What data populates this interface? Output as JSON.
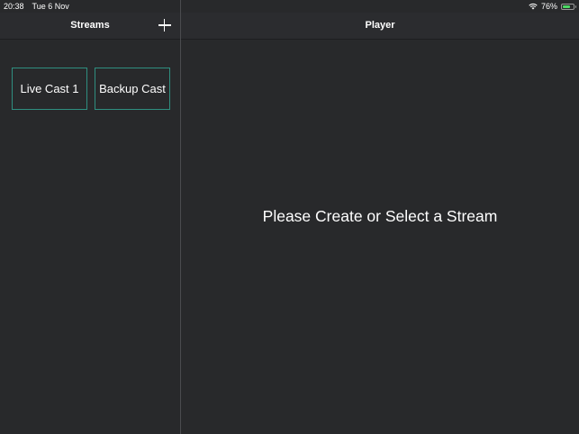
{
  "status_bar": {
    "time": "20:38",
    "date": "Tue 6 Nov",
    "battery_percent_label": "76%",
    "battery_level": 0.76,
    "wifi_icon": "wifi-icon",
    "battery_icon": "battery-icon"
  },
  "sidebar": {
    "title": "Streams",
    "add_icon": "plus-icon",
    "streams": [
      {
        "label": "Live Cast 1"
      },
      {
        "label": "Backup Cast"
      }
    ]
  },
  "player": {
    "title": "Player",
    "placeholder": "Please Create or Select a Stream"
  },
  "colors": {
    "background": "#28292b",
    "card_border": "#2f8f80",
    "battery": "#4cd964"
  }
}
